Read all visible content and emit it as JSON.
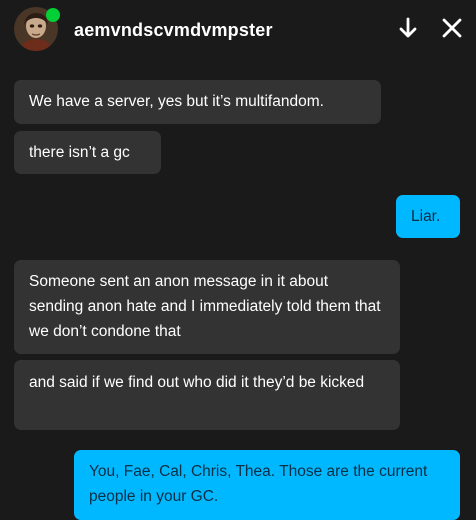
{
  "header": {
    "username": "aemvndscvmdvmpster",
    "avatar_icon": "profile-avatar",
    "status_color": "#00cf35",
    "actions": [
      {
        "icon": "arrow-down-icon"
      },
      {
        "icon": "close-icon"
      }
    ]
  },
  "messages": [
    {
      "direction": "incoming",
      "text": "We have a server, yes but it’s multifandom."
    },
    {
      "direction": "incoming",
      "text": "there isn’t a gc"
    },
    {
      "direction": "outgoing",
      "text": "Liar."
    },
    {
      "direction": "incoming",
      "text": "Someone sent an anon message in it about sending anon hate and I immediately told them that we don’t condone that"
    },
    {
      "direction": "incoming",
      "text": "and said if we find out who did it they’d be kicked"
    },
    {
      "direction": "outgoing",
      "text": "You, Fae, Cal, Chris, Thea. Those are the current people in your GC."
    }
  ],
  "colors": {
    "background": "#1a1a1a",
    "incoming_bubble": "#333333",
    "outgoing_bubble": "#00b8ff",
    "outgoing_text": "#0b2f45"
  }
}
